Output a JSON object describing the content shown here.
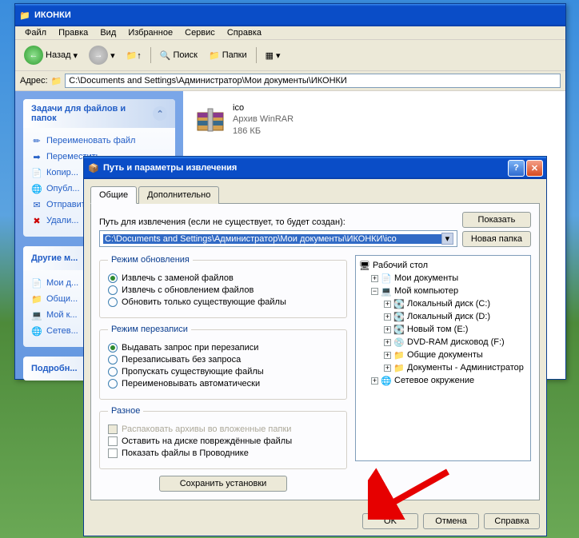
{
  "explorer": {
    "title": "ИКОНКИ",
    "menu": [
      "Файл",
      "Правка",
      "Вид",
      "Избранное",
      "Сервис",
      "Справка"
    ],
    "toolbar": {
      "back": "Назад",
      "search": "Поиск",
      "folders": "Папки"
    },
    "address_label": "Адрес:",
    "address": "C:\\Documents and Settings\\Администратор\\Мои документы\\ИКОНКИ",
    "tasks_title": "Задачи для файлов и папок",
    "tasks": [
      {
        "icon": "rename",
        "label": "Переименовать файл"
      },
      {
        "icon": "move",
        "label": "Переместить..."
      },
      {
        "icon": "copy",
        "label": "Копир..."
      },
      {
        "icon": "publish",
        "label": "Опубл..."
      },
      {
        "icon": "email",
        "label": "Отправить электр..."
      },
      {
        "icon": "delete",
        "label": "Удали..."
      }
    ],
    "other_title": "Другие м...",
    "other": [
      {
        "icon": "mydocs",
        "label": "Мои д..."
      },
      {
        "icon": "shared",
        "label": "Общи..."
      },
      {
        "icon": "mycomp",
        "label": "Мой к..."
      },
      {
        "icon": "network",
        "label": "Сетев..."
      }
    ],
    "details_title": "Подробн...",
    "file": {
      "name": "ico",
      "type": "Архив WinRAR",
      "size": "186 КБ"
    }
  },
  "dialog": {
    "title": "Путь и параметры извлечения",
    "tabs": {
      "general": "Общие",
      "advanced": "Дополнительно"
    },
    "path_label": "Путь для извлечения (если не существует, то будет создан):",
    "path": "C:\\Documents and Settings\\Администратор\\Мои документы\\ИКОНКИ\\ico",
    "show": "Показать",
    "newfolder": "Новая папка",
    "update": {
      "legend": "Режим обновления",
      "opts": [
        "Извлечь с заменой файлов",
        "Извлечь с обновлением файлов",
        "Обновить только существующие файлы"
      ]
    },
    "overwrite": {
      "legend": "Режим перезаписи",
      "opts": [
        "Выдавать запрос при перезаписи",
        "Перезаписывать без запроса",
        "Пропускать существующие файлы",
        "Переименовывать автоматически"
      ]
    },
    "misc": {
      "legend": "Разное",
      "opts": [
        "Распаковать архивы во вложенные папки",
        "Оставить на диске повреждённые файлы",
        "Показать файлы в Проводнике"
      ]
    },
    "save": "Сохранить установки",
    "tree": {
      "desktop": "Рабочий стол",
      "mydocs": "Мои документы",
      "mycomp": "Мой компьютер",
      "drives": [
        "Локальный диск (C:)",
        "Локальный диск (D:)",
        "Новый том (E:)",
        "DVD-RAM дисковод (F:)",
        "Общие документы",
        "Документы - Администратор"
      ],
      "network": "Сетевое окружение"
    },
    "ok": "OK",
    "cancel": "Отмена",
    "help": "Справка"
  }
}
